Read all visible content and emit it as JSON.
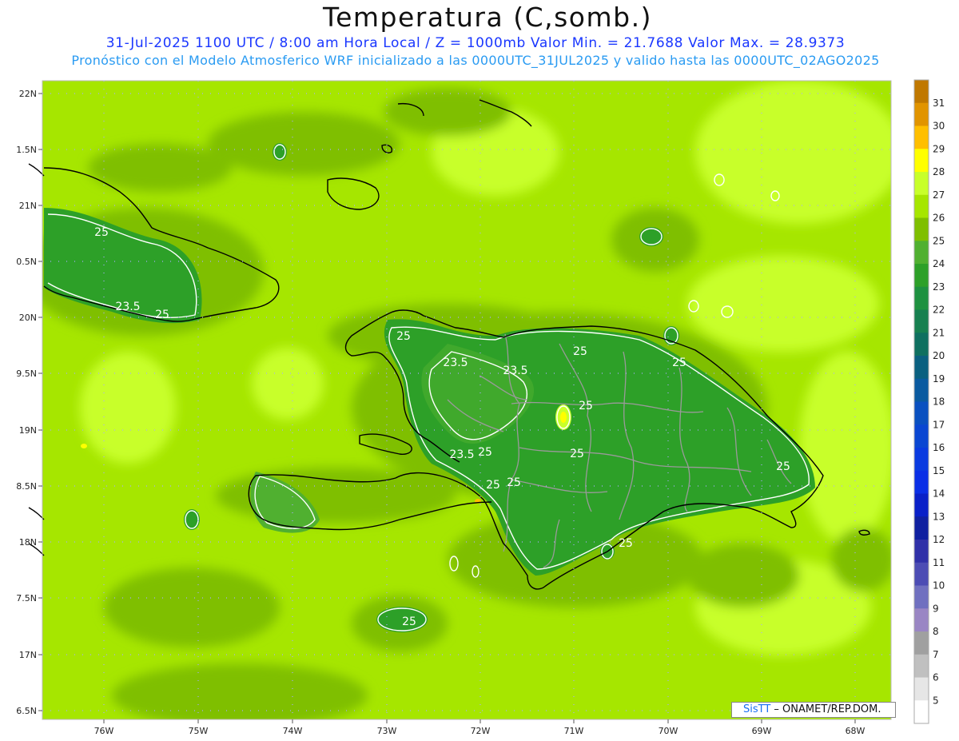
{
  "title": "Temperatura (C,somb.)",
  "subtitle_line1": "31-Jul-2025  1100 UTC / 8:00 am Hora Local / Z = 1000mb   Valor Min. = 21.7688  Valor Max. = 28.9373",
  "subtitle_line2": "Pronóstico con el Modelo Atmosferico WRF inicializado a las 0000UTC_31JUL2025 y valido hasta las  0000UTC_02AGO2025",
  "credit_logo": "SisTT",
  "credit_text": " – ONAMET/REP.DOM.",
  "lat_ticks": [
    "22N",
    "1.5N",
    "21N",
    "0.5N",
    "20N",
    "9.5N",
    "19N",
    "8.5N",
    "18N",
    "7.5N",
    "17N",
    "6.5N"
  ],
  "lon_ticks": [
    "76W",
    "75W",
    "74W",
    "73W",
    "72W",
    "71W",
    "70W",
    "69W",
    "68W"
  ],
  "colorbar": {
    "labels": [
      "31",
      "30",
      "29",
      "28",
      "27",
      "26",
      "25",
      "24",
      "23",
      "22",
      "21",
      "20",
      "19",
      "18",
      "17",
      "16",
      "15",
      "14",
      "13",
      "12",
      "11",
      "10",
      "9",
      "8",
      "7",
      "6",
      "5"
    ],
    "colors": [
      "#c07800",
      "#e19400",
      "#ffbf00",
      "#ffff00",
      "#c8ff2a",
      "#a6e600",
      "#7fbf00",
      "#50b030",
      "#2da028",
      "#1e9140",
      "#178050",
      "#0f7060",
      "#0a6080",
      "#0a5aa0",
      "#0a50c0",
      "#0a46d2",
      "#0a3ae0",
      "#0a2ee6",
      "#0a20c8",
      "#1020a0",
      "#3030a8",
      "#4c4cb4",
      "#7070c0",
      "#9a86c4",
      "#a0a0a0",
      "#c0c0c0",
      "#e6e6e6",
      "#ffffff"
    ]
  },
  "contour_labels": [
    {
      "text": "25"
    },
    {
      "text": "23.5"
    },
    {
      "text": "25"
    },
    {
      "text": "25"
    },
    {
      "text": "23.5"
    },
    {
      "text": "23.5"
    },
    {
      "text": "25"
    },
    {
      "text": "25"
    },
    {
      "text": "25"
    },
    {
      "text": "25"
    },
    {
      "text": "23.5"
    },
    {
      "text": "25"
    },
    {
      "text": "25"
    },
    {
      "text": "25"
    },
    {
      "text": "25"
    },
    {
      "text": "25"
    },
    {
      "text": "25"
    }
  ]
}
